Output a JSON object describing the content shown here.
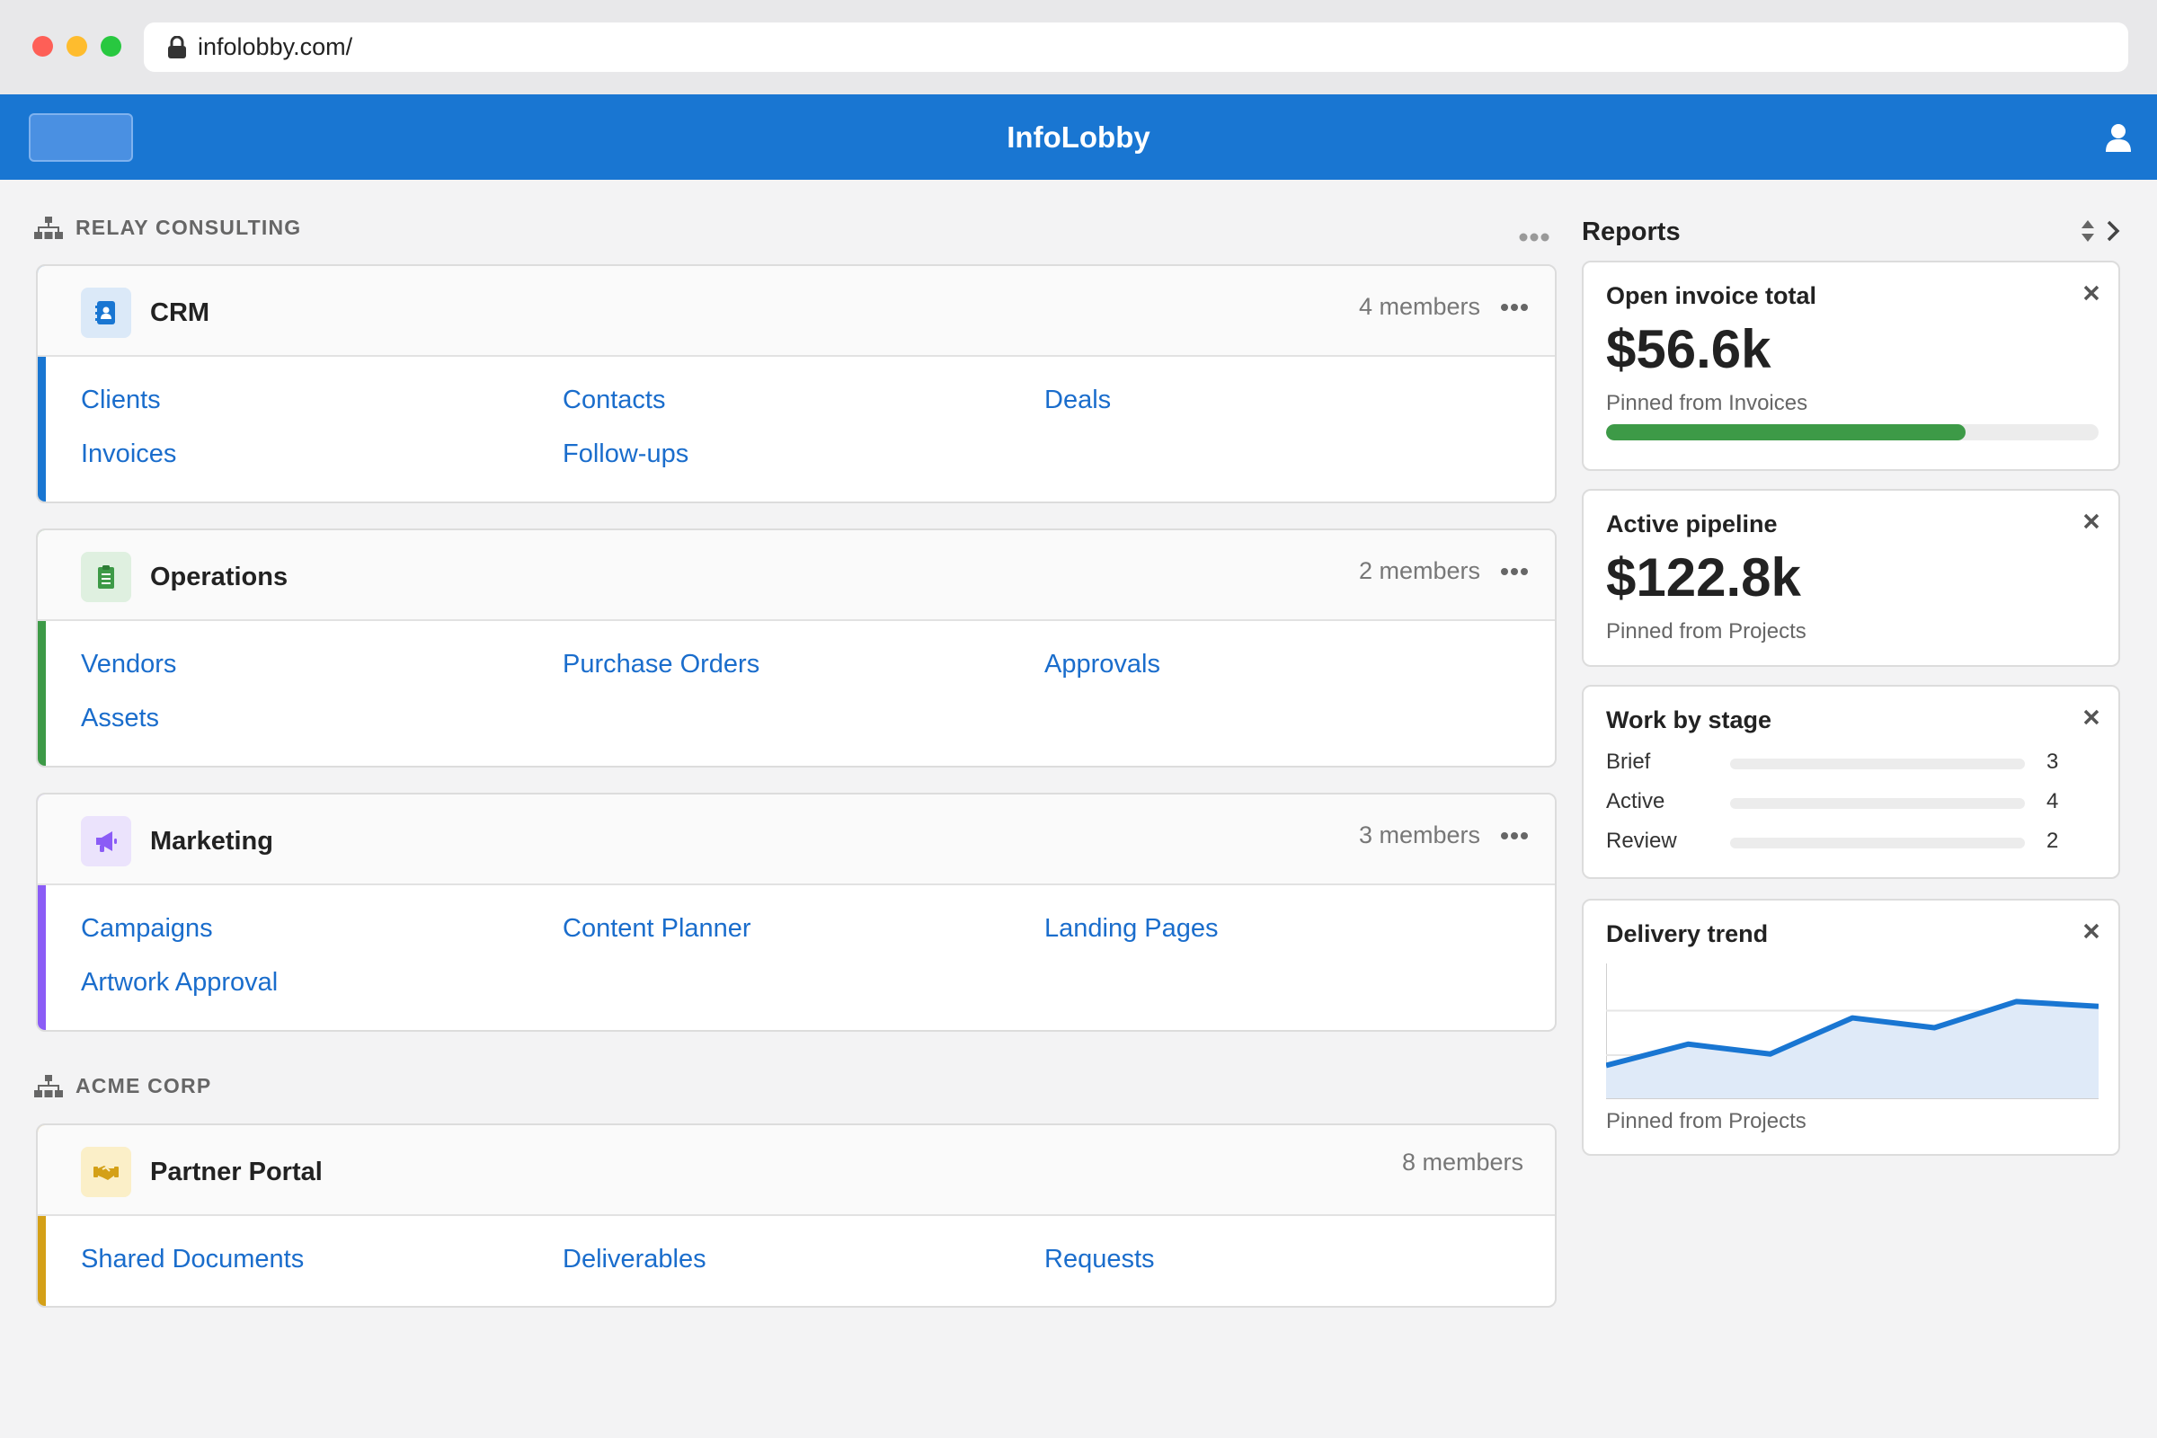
{
  "browser": {
    "url": "infolobby.com/"
  },
  "app": {
    "title": "InfoLobby"
  },
  "groups": [
    {
      "name": "RELAY CONSULTING",
      "workspaces": [
        {
          "name": "CRM",
          "members": "4 members",
          "accent": "#1976d2",
          "icon": "contact-book-icon",
          "links": [
            "Clients",
            "Contacts",
            "Deals",
            "Invoices",
            "Follow-ups"
          ]
        },
        {
          "name": "Operations",
          "members": "2 members",
          "accent": "#3d9a47",
          "icon": "clipboard-icon",
          "links": [
            "Vendors",
            "Purchase Orders",
            "Approvals",
            "Assets"
          ]
        },
        {
          "name": "Marketing",
          "members": "3 members",
          "accent": "#8b5cf6",
          "icon": "megaphone-icon",
          "links": [
            "Campaigns",
            "Content Planner",
            "Landing Pages",
            "Artwork Approval"
          ]
        }
      ]
    },
    {
      "name": "ACME CORP",
      "workspaces": [
        {
          "name": "Partner Portal",
          "members": "8 members",
          "accent": "#d4a017",
          "icon": "handshake-icon",
          "links": [
            "Shared Documents",
            "Deliverables",
            "Requests"
          ]
        }
      ]
    }
  ],
  "reports": {
    "title": "Reports",
    "open_invoice": {
      "title": "Open invoice total",
      "value": "$56.6k",
      "sub": "Pinned from Invoices",
      "progress": 0.73
    },
    "pipeline": {
      "title": "Active pipeline",
      "value": "$122.8k",
      "sub": "Pinned from Projects"
    },
    "stage": {
      "title": "Work by stage",
      "rows": [
        {
          "label": "Brief",
          "count": "3"
        },
        {
          "label": "Active",
          "count": "4"
        },
        {
          "label": "Review",
          "count": "2"
        }
      ]
    },
    "trend": {
      "title": "Delivery trend",
      "sub": "Pinned from Projects",
      "values": [
        2.0,
        3.3,
        2.7,
        4.9,
        4.3,
        5.9,
        5.6
      ],
      "ymax": 8
    }
  },
  "colors": {
    "primary": "#1976d2",
    "link": "#1a6dcc",
    "success": "#3d9a47"
  }
}
